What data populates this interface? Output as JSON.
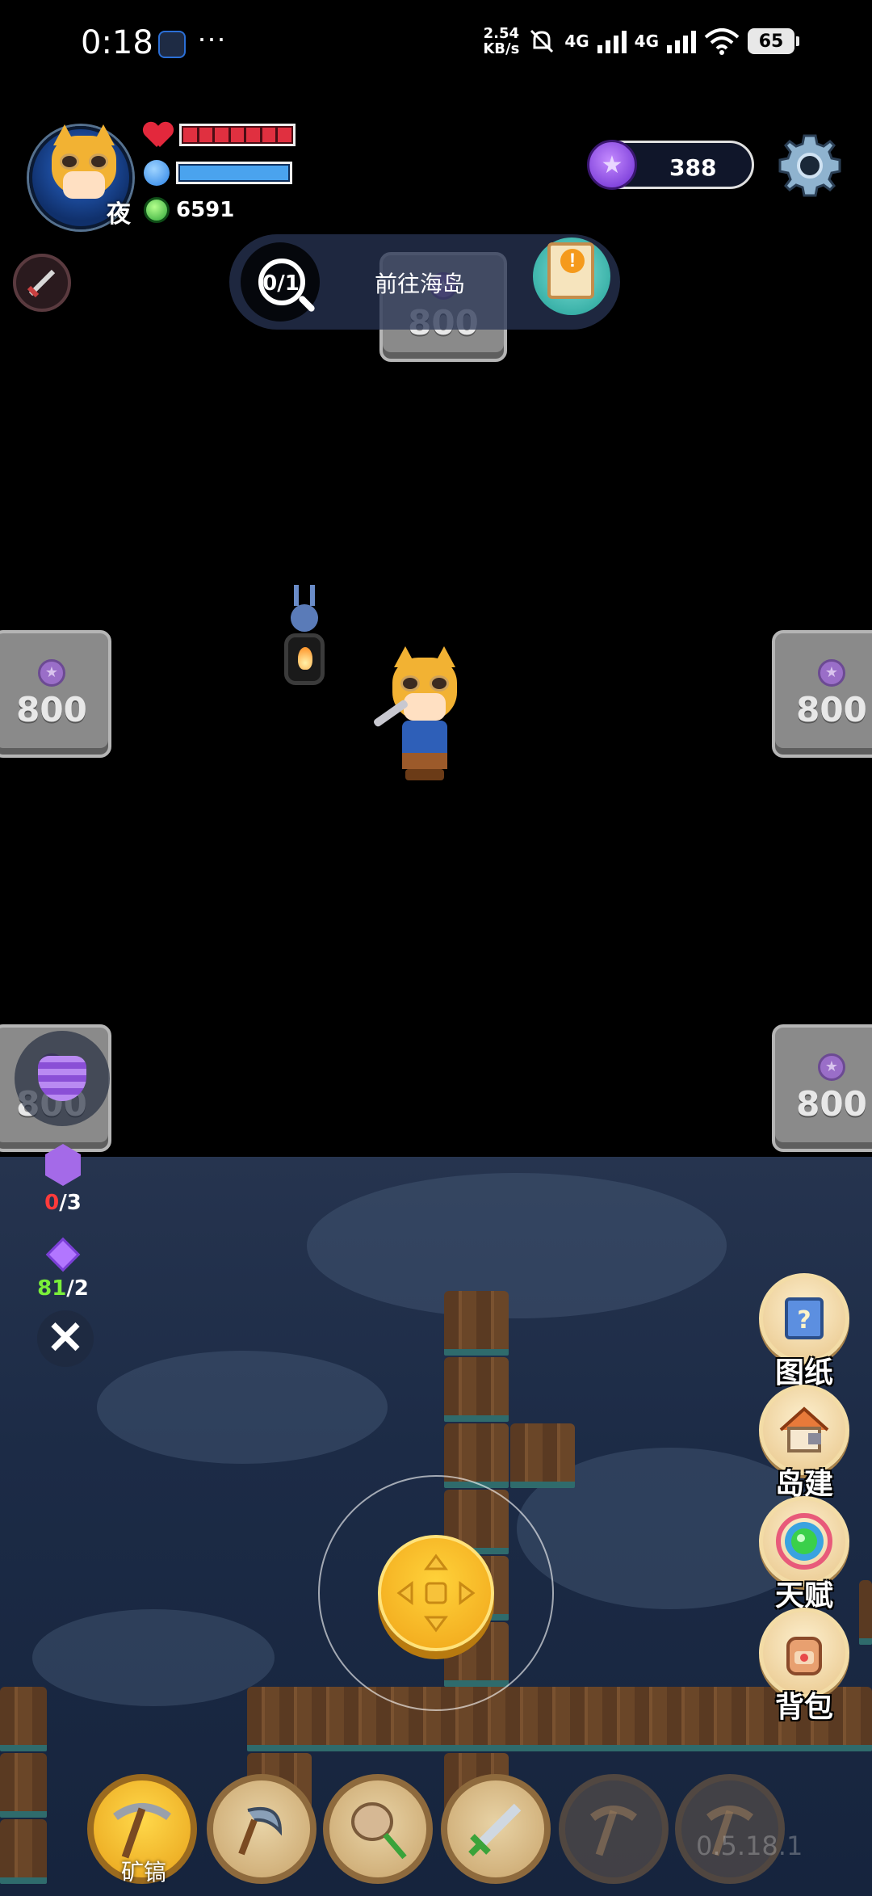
{
  "status_bar": {
    "time": "0:18",
    "more": "···",
    "net_speed_value": "2.54",
    "net_speed_unit": "KB/s",
    "signal_1": "4G",
    "signal_2": "4G",
    "battery": "65"
  },
  "player": {
    "name": "夜",
    "health_segments": 7,
    "mana_fraction": 1.0,
    "coins": "6591"
  },
  "currency": {
    "value": "388"
  },
  "quest": {
    "progress": "0/1",
    "text": "前往海岛"
  },
  "price_blocks": {
    "top_center": "800",
    "mid_left": "800",
    "mid_right": "800",
    "low_left": "800",
    "low_right": "800"
  },
  "side_stats": {
    "crystal": {
      "current": "0",
      "total": "/3"
    },
    "gem": {
      "current": "81",
      "total": "/2"
    }
  },
  "menu": {
    "blueprint": "图纸",
    "island_build": "岛建",
    "talent": "天赋",
    "backpack": "背包"
  },
  "hotbar": {
    "active_tool_label": "矿镐",
    "tools": [
      "pickaxe-icon",
      "sickle-icon",
      "net-icon",
      "sword-icon",
      "locked-tool-icon",
      "locked-tool-icon"
    ]
  },
  "version": "0.5.18.1",
  "colors": {
    "health": "#e03040",
    "mana": "#4aa3ee",
    "currency": "#8a4fd6",
    "joystick": "#f0a419"
  }
}
